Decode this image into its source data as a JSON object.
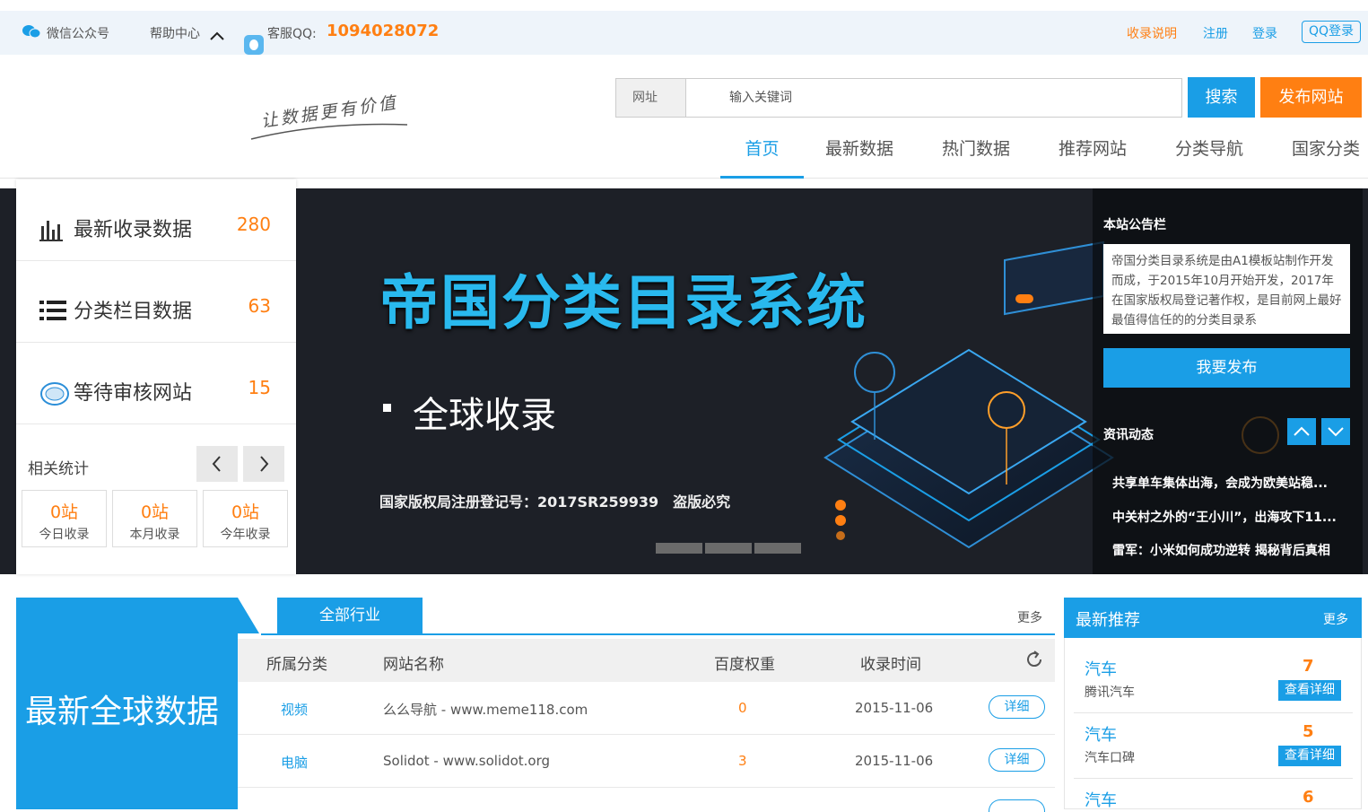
{
  "topbar": {
    "wechat": "微信公众号",
    "help": "帮助中心",
    "qq_label": "客服QQ:",
    "qq_number": "1094028072",
    "links": [
      "收录说明",
      "注册",
      "登录"
    ],
    "qq_login": "QQ登录"
  },
  "header": {
    "slogan": "让数据更有价值",
    "search_label": "网址",
    "search_placeholder": "输入关键词",
    "search_button": "搜索",
    "publish_button": "发布网站",
    "nav": [
      "首页",
      "最新数据",
      "热门数据",
      "推荐网站",
      "分类导航",
      "国家分类"
    ]
  },
  "stats": {
    "items": [
      {
        "label": "最新收录数据",
        "value": "280",
        "icon": "bar-chart-icon"
      },
      {
        "label": "分类栏目数据",
        "value": "63",
        "icon": "list-icon"
      },
      {
        "label": "等待审核网站",
        "value": "15",
        "icon": "stamp-icon"
      }
    ],
    "related_title": "相关统计",
    "boxes": [
      {
        "value": "0站",
        "label": "今日收录"
      },
      {
        "value": "0站",
        "label": "本月收录"
      },
      {
        "value": "0站",
        "label": "今年收录"
      }
    ]
  },
  "banner": {
    "title": "帝国分类目录系统",
    "subtitle": "全球收录",
    "footer": "国家版权局注册登记号：2017SR259939　盗版必究"
  },
  "notice": {
    "title": "本站公告栏",
    "text": "帝国分类目录系统是由A1模板站制作开发而成，于2015年10月开始开发，2017年在国家版权局登记著作权，是目前网上最好最值得信任的的分类目录系",
    "publish_button": "我要发布",
    "news_title": "资讯动态",
    "news": [
      "共享单车集体出海，会成为欧美站稳...",
      "中关村之外的“王小川”，出海攻下11...",
      "雷军：小米如何成功逆转 揭秘背后真相"
    ]
  },
  "latest": {
    "heading": "最新全球数据",
    "tab": "全部行业",
    "more": "更多",
    "columns": [
      "所属分类",
      "网站名称",
      "百度权重",
      "收录时间"
    ],
    "rows": [
      {
        "category": "视频",
        "name": "么么导航 - www.meme118.com",
        "weight": "0",
        "date": "2015-11-06",
        "action": "详细"
      },
      {
        "category": "电脑",
        "name": "Solidot - www.solidot.org",
        "weight": "3",
        "date": "2015-11-06",
        "action": "详细"
      }
    ]
  },
  "recommend": {
    "title": "最新推荐",
    "more": "更多",
    "items": [
      {
        "category": "汽车",
        "name": "腾讯汽车",
        "count": "7",
        "button": "查看详细"
      },
      {
        "category": "汽车",
        "name": "汽车口碑",
        "count": "5",
        "button": "查看详细"
      },
      {
        "category": "汽车",
        "name": "",
        "count": "6",
        "button": ""
      }
    ]
  },
  "colors": {
    "accent": "#1a9ee6",
    "orange": "#ff7f12"
  }
}
